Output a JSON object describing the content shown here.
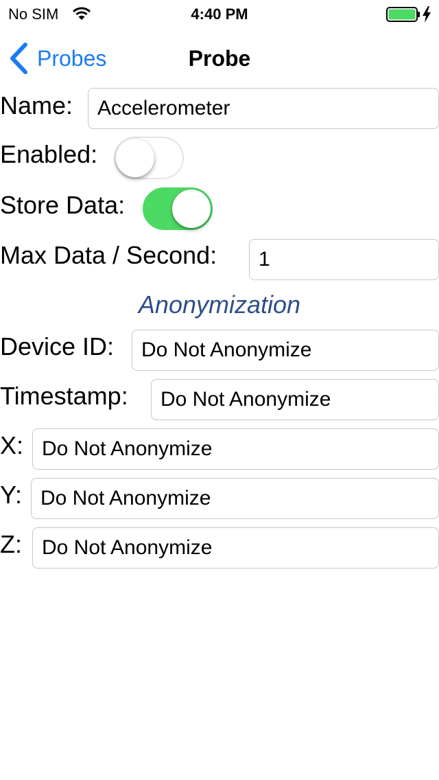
{
  "status_bar": {
    "carrier": "No SIM",
    "time": "4:40 PM",
    "battery_color": "#4cd964",
    "icons": [
      "wifi-icon",
      "battery-icon",
      "charging-bolt-icon"
    ]
  },
  "nav": {
    "back_label": "Probes",
    "title": "Probe",
    "accent_color": "#1a7cf0"
  },
  "form": {
    "name_label": "Name:",
    "name_value": "Accelerometer",
    "enabled_label": "Enabled:",
    "enabled": false,
    "store_data_label": "Store Data:",
    "store_data": true,
    "max_data_label": "Max Data / Second:",
    "max_data_value": "1"
  },
  "anonymization": {
    "title": "Anonymization",
    "title_color": "#2d4e8a",
    "fields": [
      {
        "label": "Device ID:",
        "value": "Do Not Anonymize"
      },
      {
        "label": "Timestamp:",
        "value": "Do Not Anonymize"
      },
      {
        "label": "X:",
        "value": "Do Not Anonymize"
      },
      {
        "label": "Y:",
        "value": "Do Not Anonymize"
      },
      {
        "label": "Z:",
        "value": "Do Not Anonymize"
      }
    ]
  }
}
